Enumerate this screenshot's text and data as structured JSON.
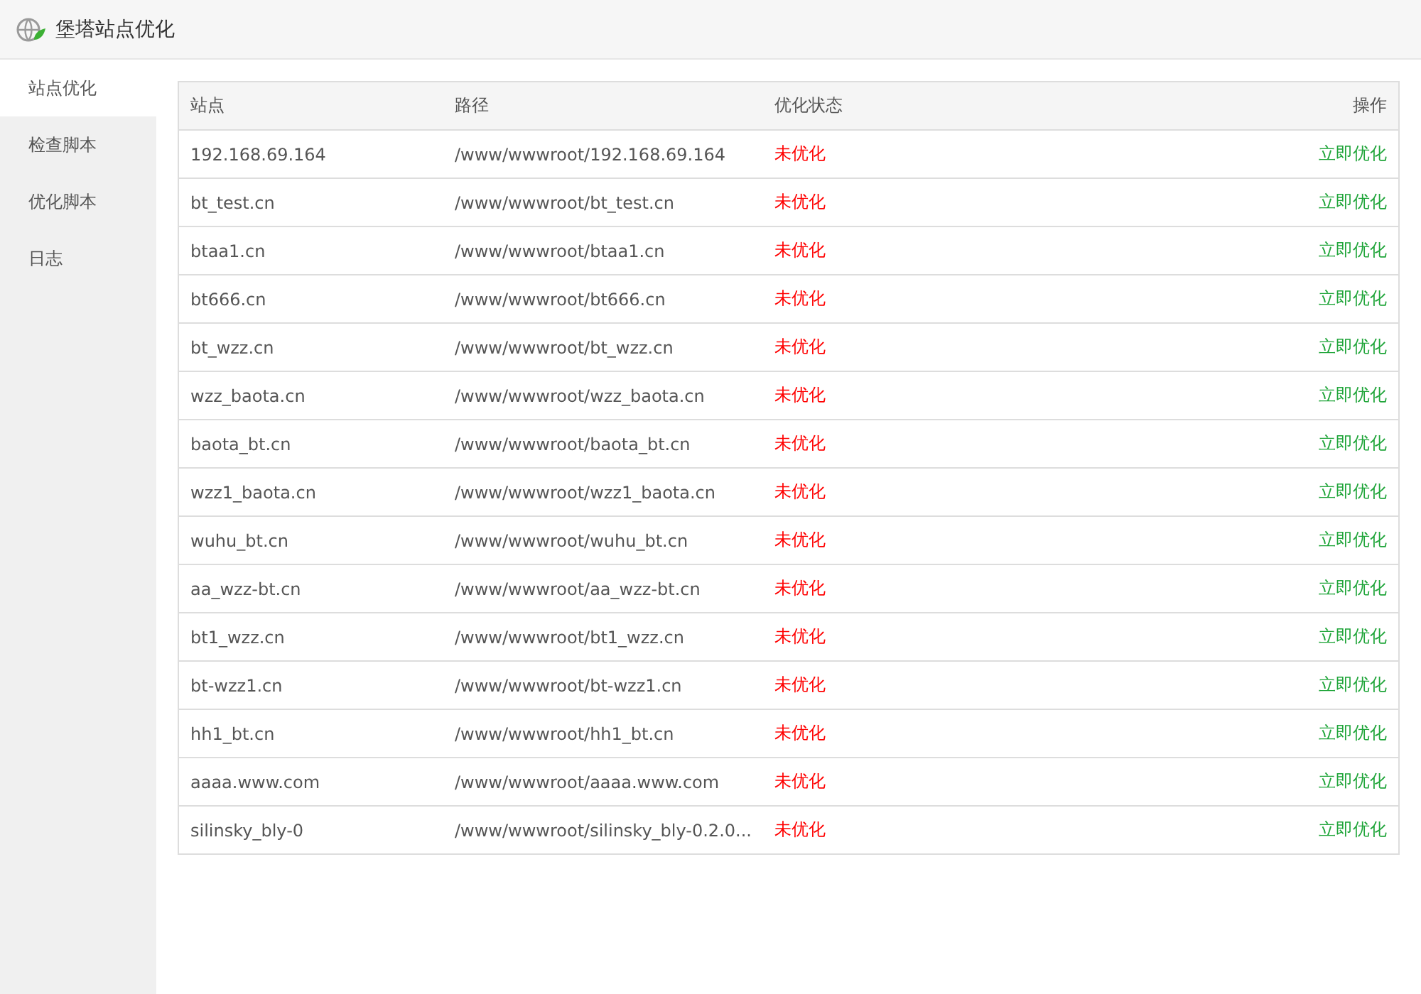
{
  "window": {
    "title": "堡塔站点优化"
  },
  "sidebar": {
    "items": [
      {
        "label": "站点优化",
        "selected": true
      },
      {
        "label": "检查脚本",
        "selected": false
      },
      {
        "label": "优化脚本",
        "selected": false
      },
      {
        "label": "日志",
        "selected": false
      }
    ]
  },
  "table": {
    "columns": [
      "站点",
      "路径",
      "优化状态",
      "操作"
    ],
    "rows": [
      {
        "site": "192.168.69.164",
        "path": "/www/wwwroot/192.168.69.164",
        "status": "未优化",
        "optimized": false,
        "action": "立即优化"
      },
      {
        "site": "bt_test.cn",
        "path": "/www/wwwroot/bt_test.cn",
        "status": "未优化",
        "optimized": false,
        "action": "立即优化"
      },
      {
        "site": "btaa1.cn",
        "path": "/www/wwwroot/btaa1.cn",
        "status": "未优化",
        "optimized": false,
        "action": "立即优化"
      },
      {
        "site": "bt666.cn",
        "path": "/www/wwwroot/bt666.cn",
        "status": "未优化",
        "optimized": false,
        "action": "立即优化"
      },
      {
        "site": "bt_wzz.cn",
        "path": "/www/wwwroot/bt_wzz.cn",
        "status": "未优化",
        "optimized": false,
        "action": "立即优化"
      },
      {
        "site": "wzz_baota.cn",
        "path": "/www/wwwroot/wzz_baota.cn",
        "status": "未优化",
        "optimized": false,
        "action": "立即优化"
      },
      {
        "site": "baota_bt.cn",
        "path": "/www/wwwroot/baota_bt.cn",
        "status": "未优化",
        "optimized": false,
        "action": "立即优化"
      },
      {
        "site": "wzz1_baota.cn",
        "path": "/www/wwwroot/wzz1_baota.cn",
        "status": "未优化",
        "optimized": false,
        "action": "立即优化"
      },
      {
        "site": "wuhu_bt.cn",
        "path": "/www/wwwroot/wuhu_bt.cn",
        "status": "未优化",
        "optimized": false,
        "action": "立即优化"
      },
      {
        "site": "aa_wzz-bt.cn",
        "path": "/www/wwwroot/aa_wzz-bt.cn",
        "status": "未优化",
        "optimized": false,
        "action": "立即优化"
      },
      {
        "site": "bt1_wzz.cn",
        "path": "/www/wwwroot/bt1_wzz.cn",
        "status": "未优化",
        "optimized": false,
        "action": "立即优化"
      },
      {
        "site": "bt-wzz1.cn",
        "path": "/www/wwwroot/bt-wzz1.cn",
        "status": "未优化",
        "optimized": false,
        "action": "立即优化"
      },
      {
        "site": "hh1_bt.cn",
        "path": "/www/wwwroot/hh1_bt.cn",
        "status": "未优化",
        "optimized": false,
        "action": "立即优化"
      },
      {
        "site": "aaaa.www.com",
        "path": "/www/wwwroot/aaaa.www.com",
        "status": "未优化",
        "optimized": false,
        "action": "立即优化"
      },
      {
        "site": "silinsky_bly-0",
        "path": "/www/wwwroot/silinsky_bly-0.2.0...",
        "status": "未优化",
        "optimized": false,
        "action": "立即优化"
      }
    ]
  }
}
